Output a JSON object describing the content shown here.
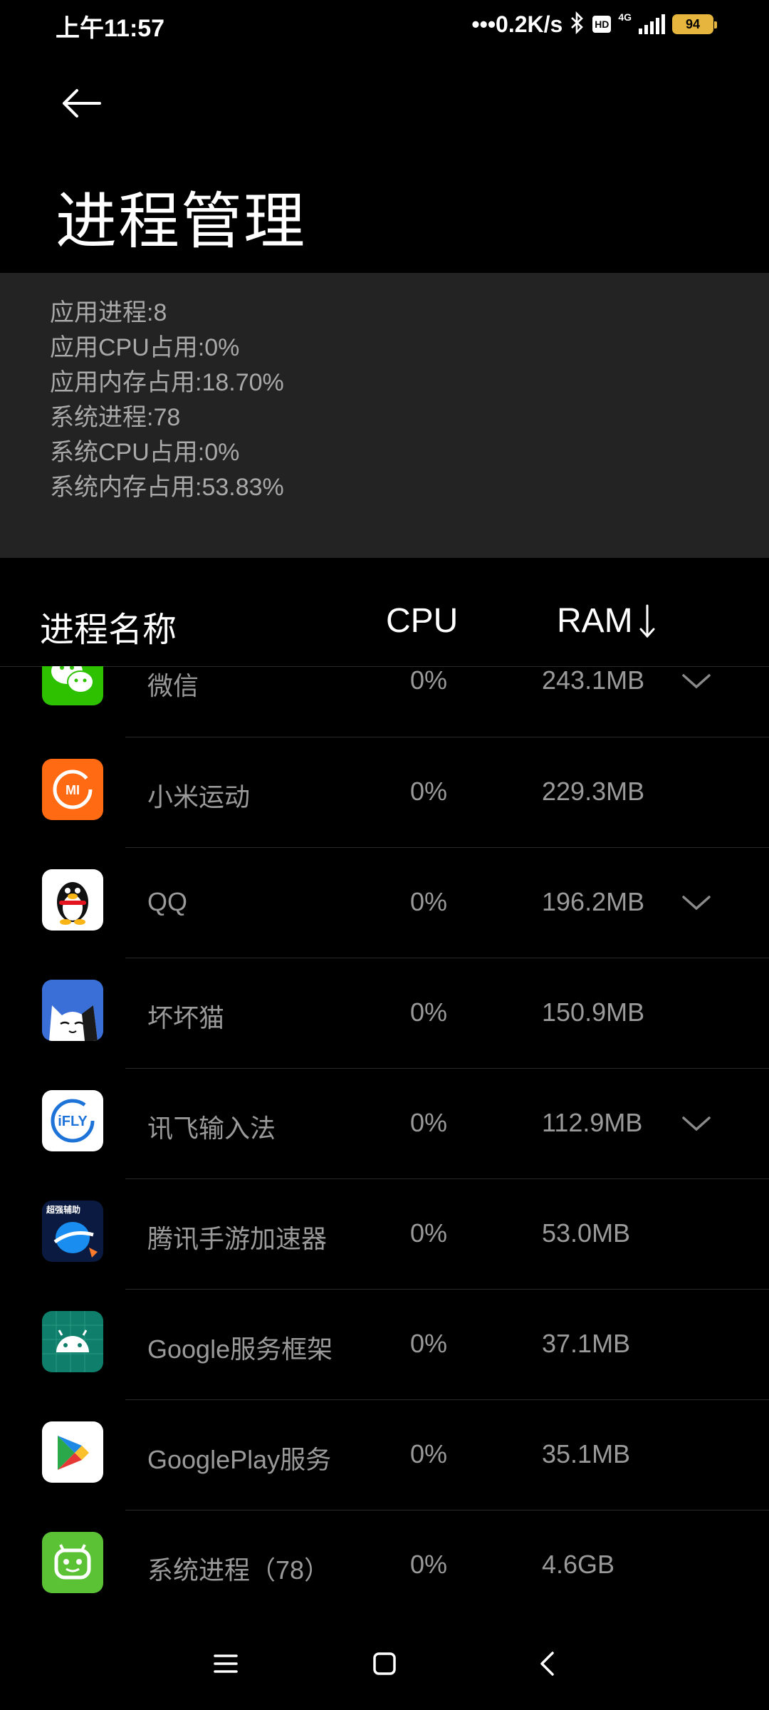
{
  "status_bar": {
    "time": "上午11:57",
    "net_speed": "•••0.2K/s",
    "bluetooth_icon": "bluetooth-icon",
    "hd_label": "HD",
    "network_type": "4G",
    "battery": "94",
    "battery_color": "#e6b53d"
  },
  "header": {
    "back_icon": "back-arrow-icon",
    "title": "进程管理"
  },
  "summary": {
    "app_processes": "应用进程:8",
    "app_cpu": "应用CPU占用:0%",
    "app_memory": "应用内存占用:18.70%",
    "sys_processes": "系统进程:78",
    "sys_cpu": "系统CPU占用:0%",
    "sys_memory": "系统内存占用:53.83%"
  },
  "columns": {
    "name": "进程名称",
    "cpu": "CPU",
    "ram": "RAM",
    "sort_icon": "sort-descending-icon"
  },
  "rows": [
    {
      "name": "微信",
      "cpu": "0%",
      "ram": "243.1MB",
      "icon": "wechat-icon",
      "expandable": true
    },
    {
      "name": "小米运动",
      "cpu": "0%",
      "ram": "229.3MB",
      "icon": "mi-fit-icon",
      "expandable": false
    },
    {
      "name": "QQ",
      "cpu": "0%",
      "ram": "196.2MB",
      "icon": "qq-penguin-icon",
      "expandable": true
    },
    {
      "name": "坏坏猫",
      "cpu": "0%",
      "ram": "150.9MB",
      "icon": "cat-icon",
      "expandable": false
    },
    {
      "name": "讯飞输入法",
      "cpu": "0%",
      "ram": "112.9MB",
      "icon": "ifly-icon",
      "expandable": true
    },
    {
      "name": "腾讯手游加速器",
      "cpu": "0%",
      "ram": "53.0MB",
      "icon": "game-booster-icon",
      "expandable": false,
      "badge": "超强辅助"
    },
    {
      "name": "Google服务框架",
      "cpu": "0%",
      "ram": "37.1MB",
      "icon": "android-icon",
      "expandable": false
    },
    {
      "name": "GooglePlay服务",
      "cpu": "0%",
      "ram": "35.1MB",
      "icon": "play-services-icon",
      "expandable": false
    },
    {
      "name": "系统进程（78）",
      "cpu": "0%",
      "ram": "4.6GB",
      "icon": "system-process-icon",
      "expandable": false
    }
  ],
  "icon_labels": {
    "mi": "MI",
    "ifly": "iFLY"
  },
  "nav": {
    "menu_icon": "menu-icon",
    "home_icon": "home-square-icon",
    "back_icon": "back-chevron-icon"
  }
}
